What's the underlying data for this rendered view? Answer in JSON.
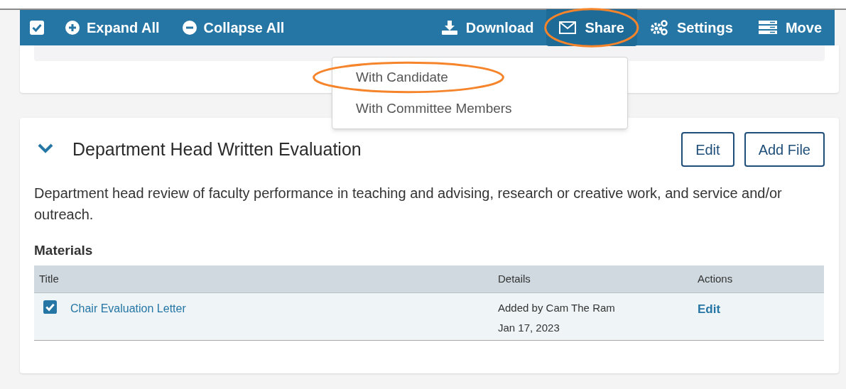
{
  "toolbar": {
    "select_all": {
      "checked": true
    },
    "left_actions": [
      {
        "kind": "expand",
        "label": "Expand All"
      },
      {
        "kind": "collapse",
        "label": "Collapse All"
      }
    ],
    "right_actions": [
      {
        "kind": "download",
        "label": "Download",
        "circled": false,
        "expanded": false
      },
      {
        "kind": "share",
        "label": "Share",
        "circled": true,
        "expanded": true
      },
      {
        "kind": "settings",
        "label": "Settings",
        "circled": false,
        "expanded": false
      },
      {
        "kind": "move",
        "label": "Move",
        "circled": false,
        "expanded": false
      }
    ]
  },
  "share_menu": [
    {
      "label": "With Candidate",
      "circled": true
    },
    {
      "label": "With Committee Members",
      "circled": false
    }
  ],
  "section": {
    "title": "Department Head Written Evaluation",
    "expanded": true,
    "buttons": [
      "Edit",
      "Add File"
    ],
    "description": "Department head review of faculty performance in teaching and advising, research or creative work, and service and/or outreach.",
    "materials": {
      "heading": "Materials",
      "columns": [
        "Title",
        "Details",
        "Actions"
      ],
      "rows": [
        {
          "title": "Chair Evaluation Letter",
          "checked": true,
          "added_by": "Added by Cam The Ram",
          "date": "Jan 17, 2023",
          "action": "Edit"
        }
      ]
    }
  }
}
